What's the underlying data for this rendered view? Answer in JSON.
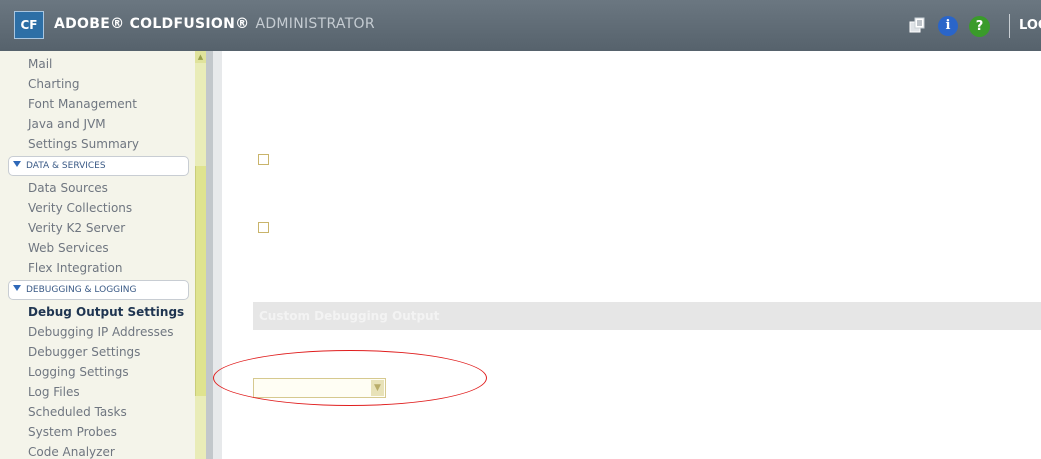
{
  "header": {
    "logo_text": "CF",
    "brand_bold": "ADOBE® COLDFUSION®",
    "brand_light": "ADMINISTRATOR",
    "logout_label": "LOG"
  },
  "sidebar": {
    "items_server": [
      "Mail",
      "Charting",
      "Font Management",
      "Java and JVM",
      "Settings Summary"
    ],
    "section_data": "DATA & SERVICES",
    "items_data": [
      "Data Sources",
      "Verity Collections",
      "Verity K2 Server",
      "Web Services",
      "Flex Integration"
    ],
    "section_debug": "DEBUGGING & LOGGING",
    "items_debug": [
      "Debug Output Settings",
      "Debugging IP Addresses",
      "Debugger Settings",
      "Logging Settings",
      "Log Files",
      "Scheduled Tasks",
      "System Probes",
      "Code Analyzer"
    ],
    "active_item": "Debug Output Settings"
  },
  "main": {
    "section_title": "Custom Debugging Output",
    "select_value": ""
  },
  "colors": {
    "header_bg": "#5f6b75",
    "sidebar_bg": "#f4f4ea",
    "accent": "#2e68b8",
    "highlight": "#e01e1e"
  }
}
